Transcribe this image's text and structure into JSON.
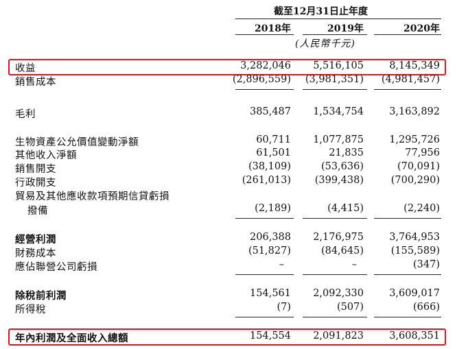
{
  "header": {
    "period": "截至12月31日止年度",
    "years": [
      "2018年",
      "2019年",
      "2020年"
    ],
    "unit": "(人民幣千元)"
  },
  "rows": [
    {
      "label": "收益",
      "values": [
        "3,282,046",
        "5,516,105",
        "8,145,349"
      ]
    },
    {
      "label": "銷售成本",
      "values": [
        "(2,896,559)",
        "(3,981,351)",
        "(4,981,457)"
      ]
    },
    {
      "label": "毛利",
      "values": [
        "385,487",
        "1,534,754",
        "3,163,892"
      ]
    },
    {
      "label": "生物資產公允價值變動淨額",
      "values": [
        "60,711",
        "1,077,875",
        "1,295,726"
      ]
    },
    {
      "label": "其他收入淨額",
      "values": [
        "61,501",
        "21,835",
        "77,956"
      ]
    },
    {
      "label": "銷售開支",
      "values": [
        "(38,109)",
        "(53,636)",
        "(70,091)"
      ]
    },
    {
      "label": "行政開支",
      "values": [
        "(261,013)",
        "(399,438)",
        "(700,290)"
      ]
    },
    {
      "label": "貿易及其他應收款項預期信貸虧損",
      "values": [
        "",
        "",
        ""
      ]
    },
    {
      "label": "撥備",
      "values": [
        "(2,189)",
        "(4,415)",
        "(2,240)"
      ]
    },
    {
      "label": "經營利潤",
      "values": [
        "206,388",
        "2,176,975",
        "3,764,953"
      ]
    },
    {
      "label": "財務成本",
      "values": [
        "(51,827)",
        "(84,645)",
        "(155,589)"
      ]
    },
    {
      "label": "應佔聯營公司虧損",
      "values": [
        "–",
        "–",
        "(347)"
      ]
    },
    {
      "label": "除稅前利潤",
      "values": [
        "154,561",
        "2,092,330",
        "3,609,017"
      ]
    },
    {
      "label": "所得稅",
      "values": [
        "(7)",
        "(507)",
        "(666)"
      ]
    },
    {
      "label": "年內利潤及全面收入總額",
      "values": [
        "154,554",
        "2,091,823",
        "3,608,351"
      ]
    }
  ],
  "colors": {
    "highlight_box": "#e8101a",
    "text": "#111111"
  }
}
